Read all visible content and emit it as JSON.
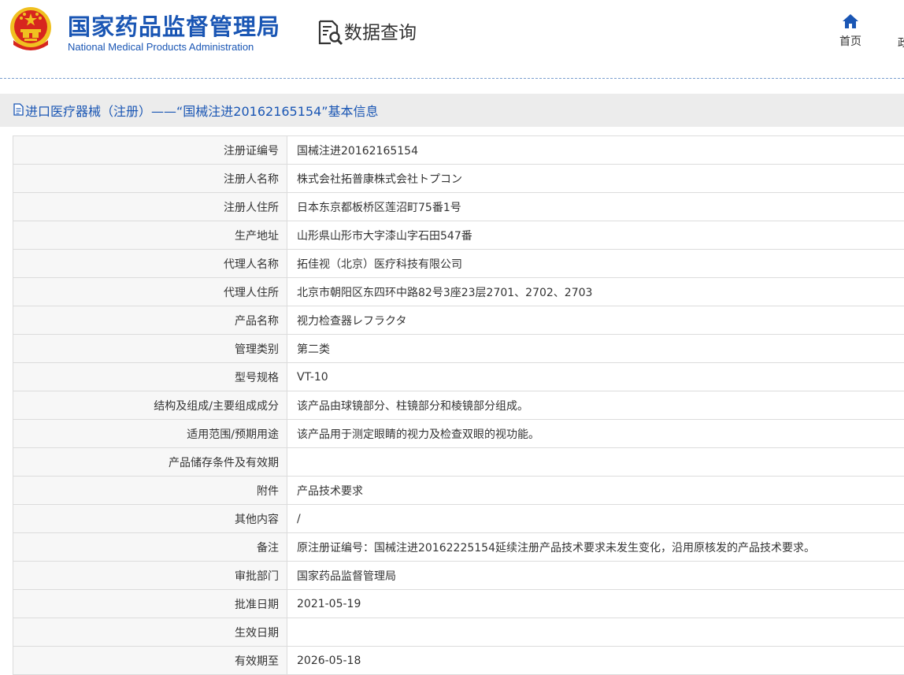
{
  "header": {
    "agency_cn": "国家药品监督管理局",
    "agency_en": "National Medical Products Administration",
    "query_title": "数据查询",
    "nav": {
      "home": "首页",
      "next_partial": "政"
    }
  },
  "colors": {
    "brand_blue": "#1a56b4",
    "emblem_red": "#d7261e",
    "emblem_gold": "#f0c020"
  },
  "icons": {
    "emblem": "national-emblem",
    "query": "document-search-icon",
    "home": "home-icon",
    "title": "document-icon"
  },
  "page": {
    "title": "进口医疗器械（注册）——“国械注进20162165154”基本信息"
  },
  "rows": [
    {
      "label": "注册证编号",
      "value": "国械注进20162165154"
    },
    {
      "label": "注册人名称",
      "value": "株式会社拓普康株式会社トプコン"
    },
    {
      "label": "注册人住所",
      "value": "日本东京都板桥区莲沼町75番1号"
    },
    {
      "label": "生产地址",
      "value": "山形県山形市大字漆山字石田547番"
    },
    {
      "label": "代理人名称",
      "value": "拓佳视（北京）医疗科技有限公司"
    },
    {
      "label": "代理人住所",
      "value": "北京市朝阳区东四环中路82号3座23层2701、2702、2703"
    },
    {
      "label": "产品名称",
      "value": "视力检查器レフラクタ"
    },
    {
      "label": "管理类别",
      "value": "第二类"
    },
    {
      "label": "型号规格",
      "value": "VT-10"
    },
    {
      "label": "结构及组成/主要组成成分",
      "value": "该产品由球镜部分、柱镜部分和棱镜部分组成。"
    },
    {
      "label": "适用范围/预期用途",
      "value": "该产品用于测定眼睛的视力及检查双眼的视功能。"
    },
    {
      "label": "产品储存条件及有效期",
      "value": ""
    },
    {
      "label": "附件",
      "value": "产品技术要求"
    },
    {
      "label": "其他内容",
      "value": "/"
    },
    {
      "label": "备注",
      "value": "原注册证编号：国械注进20162225154延续注册产品技术要求未发生变化，沿用原核发的产品技术要求。"
    },
    {
      "label": "审批部门",
      "value": "国家药品监督管理局"
    },
    {
      "label": "批准日期",
      "value": "2021-05-19"
    },
    {
      "label": "生效日期",
      "value": ""
    },
    {
      "label": "有效期至",
      "value": "2026-05-18"
    }
  ]
}
